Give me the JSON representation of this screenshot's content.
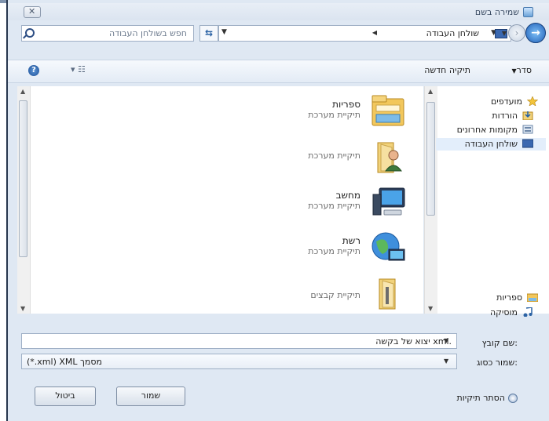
{
  "window": {
    "title": "שמירה בשם"
  },
  "search": {
    "placeholder": "חפש בשולחן העבודה"
  },
  "address": {
    "crumb": "שולחן העבודה"
  },
  "toolbar": {
    "organize": "סדר",
    "new_folder": "תיקיה חדשה",
    "help_icon": "help-icon",
    "view_icon": "view-icon"
  },
  "files": [
    {
      "name": "ספריות",
      "type": "תיקיית מערכת",
      "icon": "libraries-icon"
    },
    {
      "name": "",
      "type": "תיקיית מערכת",
      "icon": "user-folder-icon"
    },
    {
      "name": "מחשב",
      "type": "תיקיית מערכת",
      "icon": "computer-icon"
    },
    {
      "name": "רשת",
      "type": "תיקיית מערכת",
      "icon": "network-icon"
    },
    {
      "name": "",
      "type": "תיקיית קבצים",
      "icon": "folder-icon"
    }
  ],
  "nav_pane": {
    "favorites": [
      {
        "label": "מועדפים",
        "icon": "star-icon"
      },
      {
        "label": "הורדות",
        "icon": "downloads-icon"
      },
      {
        "label": "מקומות אחרונים",
        "icon": "recent-places-icon"
      },
      {
        "label": "שולחן העבודה",
        "icon": "desktop-icon"
      }
    ],
    "libraries": [
      {
        "label": "ספריות",
        "icon": "libraries-icon"
      },
      {
        "label": "מוסיקה",
        "icon": "music-icon"
      }
    ]
  },
  "form": {
    "filename_label": "שם קובץ:",
    "filename_value": "יצוא של בקשה xml.",
    "savetype_label": "שמור כסוג:",
    "savetype_value": "(*.xml) XML מסמך"
  },
  "buttons": {
    "save": "שמור",
    "cancel": "ביטול"
  },
  "hide_folders": "הסתר תיקיות",
  "colors": {
    "accent": "#1e5fb7",
    "selection": "#e3eefb",
    "frame": "#dfe8f3"
  }
}
